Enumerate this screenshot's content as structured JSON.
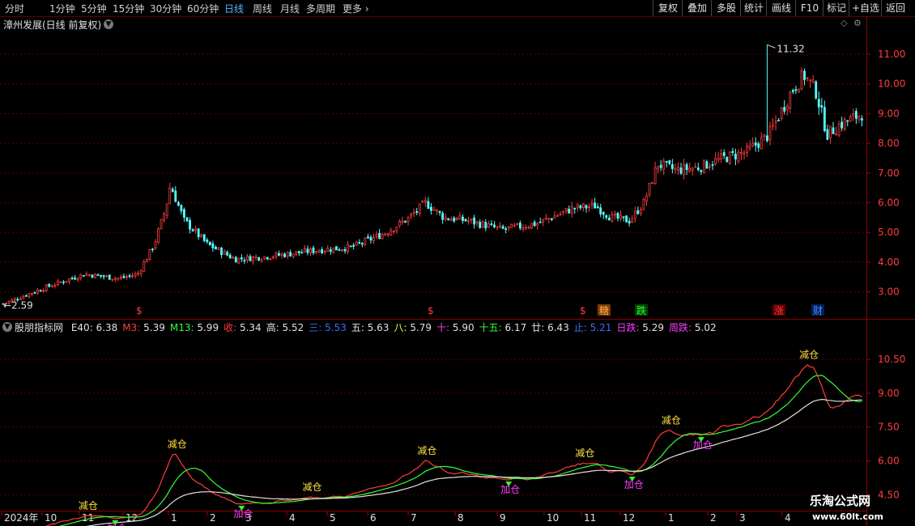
{
  "toolbar": {
    "periods": [
      "分时",
      "1分钟",
      "5分钟",
      "15分钟",
      "30分钟",
      "60分钟",
      "日线",
      "周线",
      "月线",
      "多周期",
      "更多"
    ],
    "active_index": 6,
    "buttons": [
      "复权",
      "叠加",
      "多股",
      "统计",
      "画线",
      "F10",
      "标记",
      "+自选",
      "返回"
    ]
  },
  "main": {
    "title": "漳州发展(日线 前复权)",
    "high_label": "11.32",
    "low_label": "2.59",
    "markers": [
      "$",
      "$",
      "$",
      "糖",
      "跌",
      "涨",
      "财"
    ]
  },
  "indicator": {
    "name": "股朋指标网",
    "values": [
      {
        "label": "E40:",
        "value": "6.38",
        "color": "#e0e0e0"
      },
      {
        "label": "M3:",
        "value": "5.39",
        "color": "#ff3b3b"
      },
      {
        "label": "M13:",
        "value": "5.99",
        "color": "#33ff33"
      },
      {
        "label": "收:",
        "value": "5.34",
        "color": "#ff3b3b"
      },
      {
        "label": "高:",
        "value": "5.52",
        "color": "#e0e0e0"
      },
      {
        "label": "三:",
        "value": "5.53",
        "color": "#3b6bff"
      },
      {
        "label": "五:",
        "value": "5.63",
        "color": "#e0e0e0"
      },
      {
        "label": "八:",
        "value": "5.79",
        "color": "#ffff3b"
      },
      {
        "label": "十:",
        "value": "5.90",
        "color": "#ff3bff"
      },
      {
        "label": "十五:",
        "value": "6.17",
        "color": "#33ff33"
      },
      {
        "label": "廿:",
        "value": "6.43",
        "color": "#e0e0e0"
      },
      {
        "label": "止:",
        "value": "5.21",
        "color": "#3b6bff"
      },
      {
        "label": "日跌:",
        "value": "5.29",
        "color": "#ff3bff"
      },
      {
        "label": "周跌:",
        "value": "5.02",
        "color": "#ff3bff"
      }
    ],
    "reduce_label": "减仓",
    "add_label": "加仓"
  },
  "chart_data": [
    {
      "type": "candlestick",
      "title": "漳州发展(日线 前复权)",
      "y_ticks": [
        3.0,
        4.0,
        5.0,
        6.0,
        7.0,
        8.0,
        9.0,
        10.0,
        11.0
      ],
      "ylim": [
        2.2,
        11.9
      ],
      "period_days": 370,
      "price_anchors": [
        [
          0,
          2.6
        ],
        [
          20,
          3.2
        ],
        [
          35,
          3.6
        ],
        [
          50,
          3.45
        ],
        [
          58,
          3.6
        ],
        [
          65,
          4.6
        ],
        [
          70,
          5.8
        ],
        [
          72,
          6.6
        ],
        [
          78,
          5.4
        ],
        [
          88,
          4.6
        ],
        [
          100,
          4.1
        ],
        [
          115,
          4.2
        ],
        [
          135,
          4.4
        ],
        [
          150,
          4.5
        ],
        [
          165,
          5.0
        ],
        [
          175,
          5.5
        ],
        [
          182,
          6.0
        ],
        [
          190,
          5.5
        ],
        [
          200,
          5.4
        ],
        [
          215,
          5.1
        ],
        [
          230,
          5.3
        ],
        [
          245,
          5.8
        ],
        [
          255,
          5.9
        ],
        [
          262,
          5.5
        ],
        [
          270,
          5.4
        ],
        [
          276,
          6.0
        ],
        [
          282,
          7.3
        ],
        [
          290,
          7.1
        ],
        [
          300,
          7.2
        ],
        [
          310,
          7.5
        ],
        [
          320,
          7.7
        ],
        [
          330,
          8.3
        ],
        [
          340,
          9.8
        ],
        [
          345,
          10.3
        ],
        [
          350,
          9.8
        ],
        [
          355,
          8.3
        ],
        [
          360,
          8.6
        ],
        [
          370,
          9.0
        ]
      ],
      "high": 11.32,
      "low": 2.59
    },
    {
      "type": "line",
      "title": "股朋指标网",
      "y_ticks": [
        4.5,
        6.0,
        7.5,
        9.0,
        10.5
      ],
      "ylim": [
        3.9,
        11.8
      ],
      "series": [
        {
          "name": "M3",
          "color": "#ff3b3b"
        },
        {
          "name": "M13",
          "color": "#33ff33"
        },
        {
          "name": "E40",
          "color": "#e0e0e0"
        }
      ]
    }
  ],
  "x_axis": [
    "2024年",
    "10",
    "11",
    "12",
    "1",
    "2",
    "3",
    "4",
    "5",
    "6",
    "7",
    "8",
    "9",
    "10",
    "11",
    "12",
    "1",
    "2",
    "3",
    "4"
  ],
  "watermark": {
    "name": "乐淘公式网",
    "url": "www.60lt.com"
  }
}
